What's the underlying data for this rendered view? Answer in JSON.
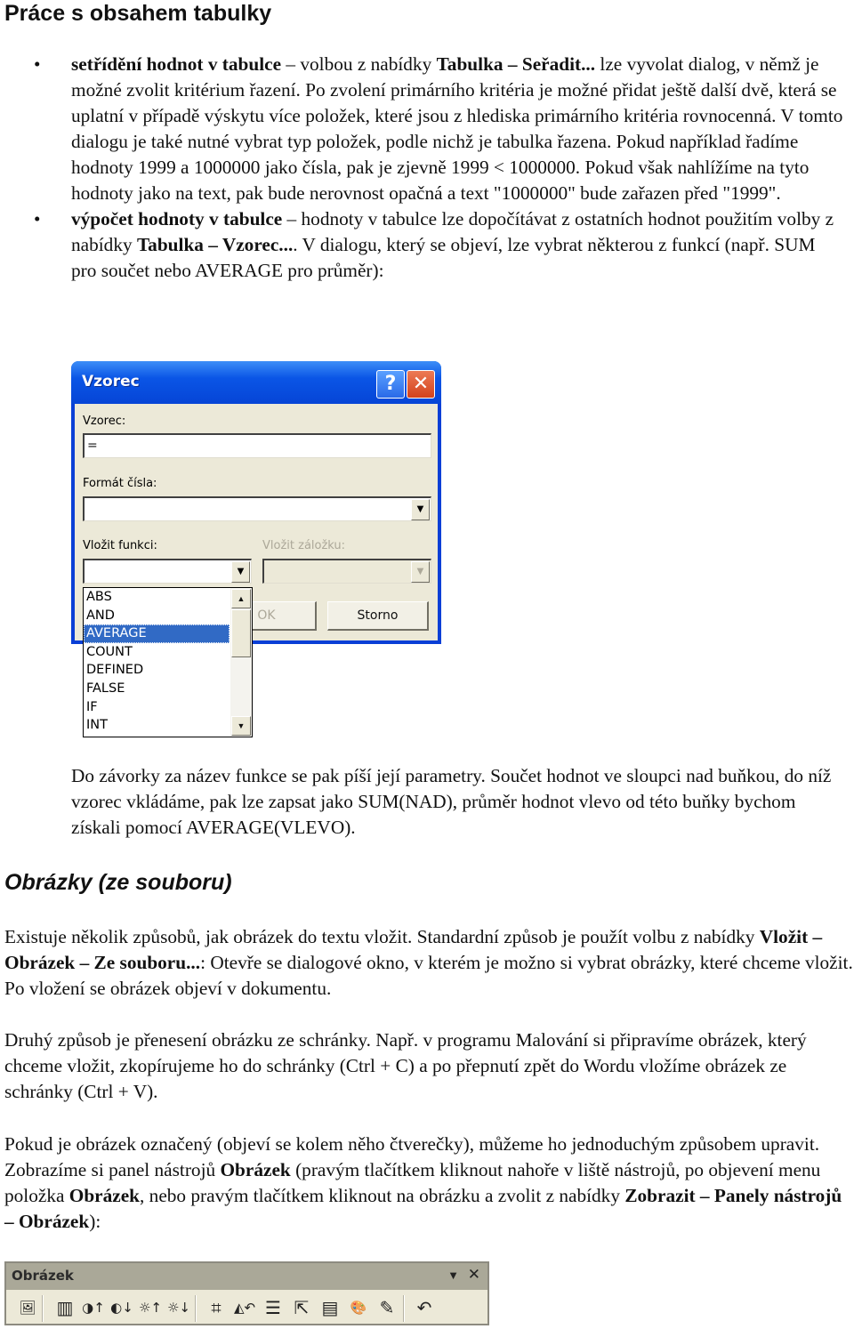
{
  "heading1": "Práce s obsahem tabulky",
  "bullets": [
    {
      "bold": "setřídění hodnot v tabulce",
      "t1": " – volbou z nabídky ",
      "b2": "Tabulka – Seřadit...",
      "t2": " lze vyvolat dialog, v němž je možné zvolit kritérium řazení. Po zvolení primárního kritéria je možné přidat ještě další dvě, která se uplatní v případě výskytu více položek, které jsou z hlediska primárního kritéria rovnocenná. V tomto dialogu je také nutné vybrat typ položek, podle nichž je tabulka řazena. Pokud například řadíme hodnoty 1999 a 1000000 jako čísla, pak je zjevně 1999 < 1000000. Pokud však nahlížíme na tyto hodnoty jako na text, pak bude nerovnost opačná a text \"1000000\" bude zařazen před \"1999\"."
    },
    {
      "bold": "výpočet hodnoty v tabulce",
      "t1": " – hodnoty v tabulce lze dopočítávat z ostatních hodnot použitím volby z nabídky ",
      "b2": "Tabulka – Vzorec...",
      "t2": ". V dialogu, který se objeví, lze vybrat některou z funkcí (např. SUM pro součet nebo AVERAGE pro průměr):"
    }
  ],
  "dialog": {
    "title": "Vzorec",
    "help_glyph": "?",
    "close_glyph": "✕",
    "formula_label": "Vzorec:",
    "formula_value": "=",
    "number_format_label": "Formát čísla:",
    "number_format_value": "",
    "insert_function_label": "Vložit funkci:",
    "insert_bookmark_label": "Vložit záložku:",
    "ok_label": "OK",
    "cancel_label": "Storno",
    "function_list": [
      "ABS",
      "AND",
      "AVERAGE",
      "COUNT",
      "DEFINED",
      "FALSE",
      "IF",
      "INT"
    ],
    "selected_function": "AVERAGE"
  },
  "para_after_dialog": "Do závorky za název funkce se pak píší její parametry. Součet hodnot ve sloupci nad buňkou, do níž vzorec vkládáme, pak lze zapsat jako SUM(NAD), průměr hodnot vlevo od této buňky bychom získali pomocí AVERAGE(VLEVO).",
  "heading2": "Obrázky (ze souboru)",
  "para1": {
    "t1": "Existuje několik způsobů, jak obrázek do textu vložit. Standardní způsob je použít volbu z nabídky ",
    "b1": "Vložit – Obrázek – Ze souboru...",
    "t2": ": Otevře se dialogové okno, v kterém je možno si vybrat obrázky, které chceme vložit. Po vložení se obrázek objeví v dokumentu."
  },
  "para2": "Druhý způsob je přenesení obrázku ze schránky. Např. v programu Malování si připravíme obrázek, který chceme vložit, zkopírujeme ho do schránky (Ctrl + C) a po přepnutí zpět do Wordu vložíme obrázek ze schránky (Ctrl + V).",
  "para3": {
    "t1": "Pokud je obrázek označený (objeví se kolem něho čtverečky), můžeme ho jednoduchým způsobem upravit. Zobrazíme si panel nástrojů ",
    "b1": "Obrázek",
    "t2": " (pravým tlačítkem kliknout nahoře v liště nástrojů, po objevení menu položka ",
    "b2": "Obrázek",
    "t3": ", nebo pravým tlačítkem kliknout na obrázku a zvolit z nabídky ",
    "b3": "Zobrazit – Panely nástrojů – Obrázek",
    "t4": "):"
  },
  "toolbar": {
    "title": "Obrázek",
    "dropdown_glyph": "▼",
    "close_glyph": "✕",
    "icons": [
      {
        "name": "insert-picture-icon",
        "glyph": "🖼"
      },
      {
        "name": "color-icon",
        "glyph": "▥"
      },
      {
        "name": "more-contrast-icon",
        "glyph": "◑↑"
      },
      {
        "name": "less-contrast-icon",
        "glyph": "◐↓"
      },
      {
        "name": "more-brightness-icon",
        "glyph": "☼↑"
      },
      {
        "name": "less-brightness-icon",
        "glyph": "☼↓"
      },
      {
        "name": "crop-icon",
        "glyph": "⌗"
      },
      {
        "name": "rotate-left-icon",
        "glyph": "◭↶"
      },
      {
        "name": "line-style-icon",
        "glyph": "☰"
      },
      {
        "name": "compress-pictures-icon",
        "glyph": "⇱"
      },
      {
        "name": "text-wrapping-icon",
        "glyph": "▤"
      },
      {
        "name": "format-picture-icon",
        "glyph": "🎨"
      },
      {
        "name": "set-transparent-color-icon",
        "glyph": "✎"
      },
      {
        "name": "reset-picture-icon",
        "glyph": "↶"
      }
    ]
  }
}
